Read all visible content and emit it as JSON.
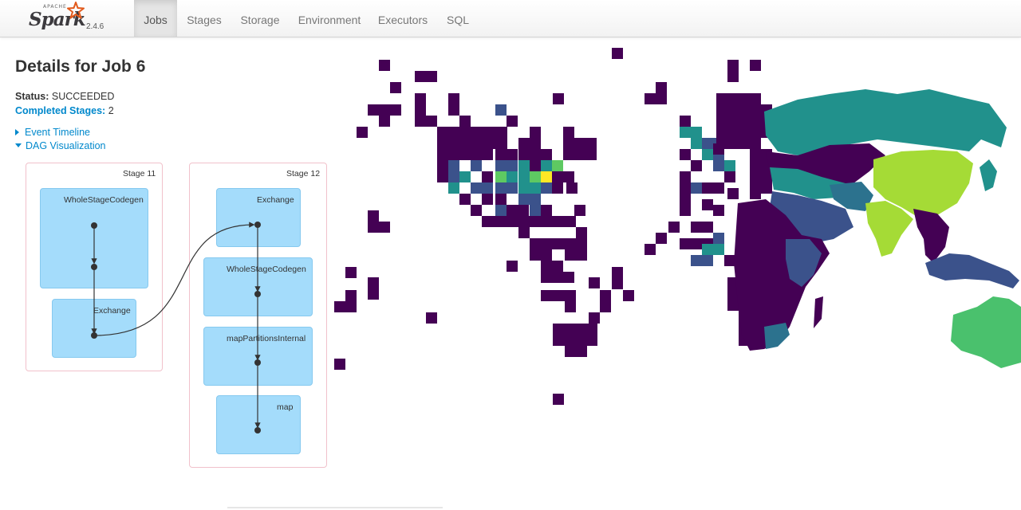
{
  "brand": {
    "apache_text": "APACHE",
    "spark_text": "Spark",
    "version": "2.4.6"
  },
  "nav": {
    "tabs": [
      {
        "label": "Jobs",
        "active": true
      },
      {
        "label": "Stages",
        "active": false
      },
      {
        "label": "Storage",
        "active": false
      },
      {
        "label": "Environment",
        "active": false
      },
      {
        "label": "Executors",
        "active": false
      },
      {
        "label": "SQL",
        "active": false
      }
    ]
  },
  "job": {
    "title": "Details for Job 6",
    "status_label": "Status:",
    "status_value": "SUCCEEDED",
    "completed_label": "Completed Stages:",
    "completed_value": "2"
  },
  "expanders": {
    "event_timeline": "Event Timeline",
    "dag_visualization": "DAG Visualization"
  },
  "dag": {
    "stages": [
      {
        "label": "Stage 11",
        "ops": [
          "WholeStageCodegen",
          "Exchange"
        ]
      },
      {
        "label": "Stage 12",
        "ops": [
          "Exchange",
          "WholeStageCodegen",
          "mapPartitionsInternal",
          "map"
        ]
      }
    ]
  },
  "colors": {
    "accent_link": "#0088cc",
    "op_fill": "#a4dcfb",
    "stage_border": "#f1c1cb",
    "map_dark": "#440154",
    "map_blue": "#3b528b",
    "map_teal": "#21918c",
    "map_green": "#5ec962",
    "map_lime": "#a5db36",
    "map_yellow": "#fde725"
  }
}
